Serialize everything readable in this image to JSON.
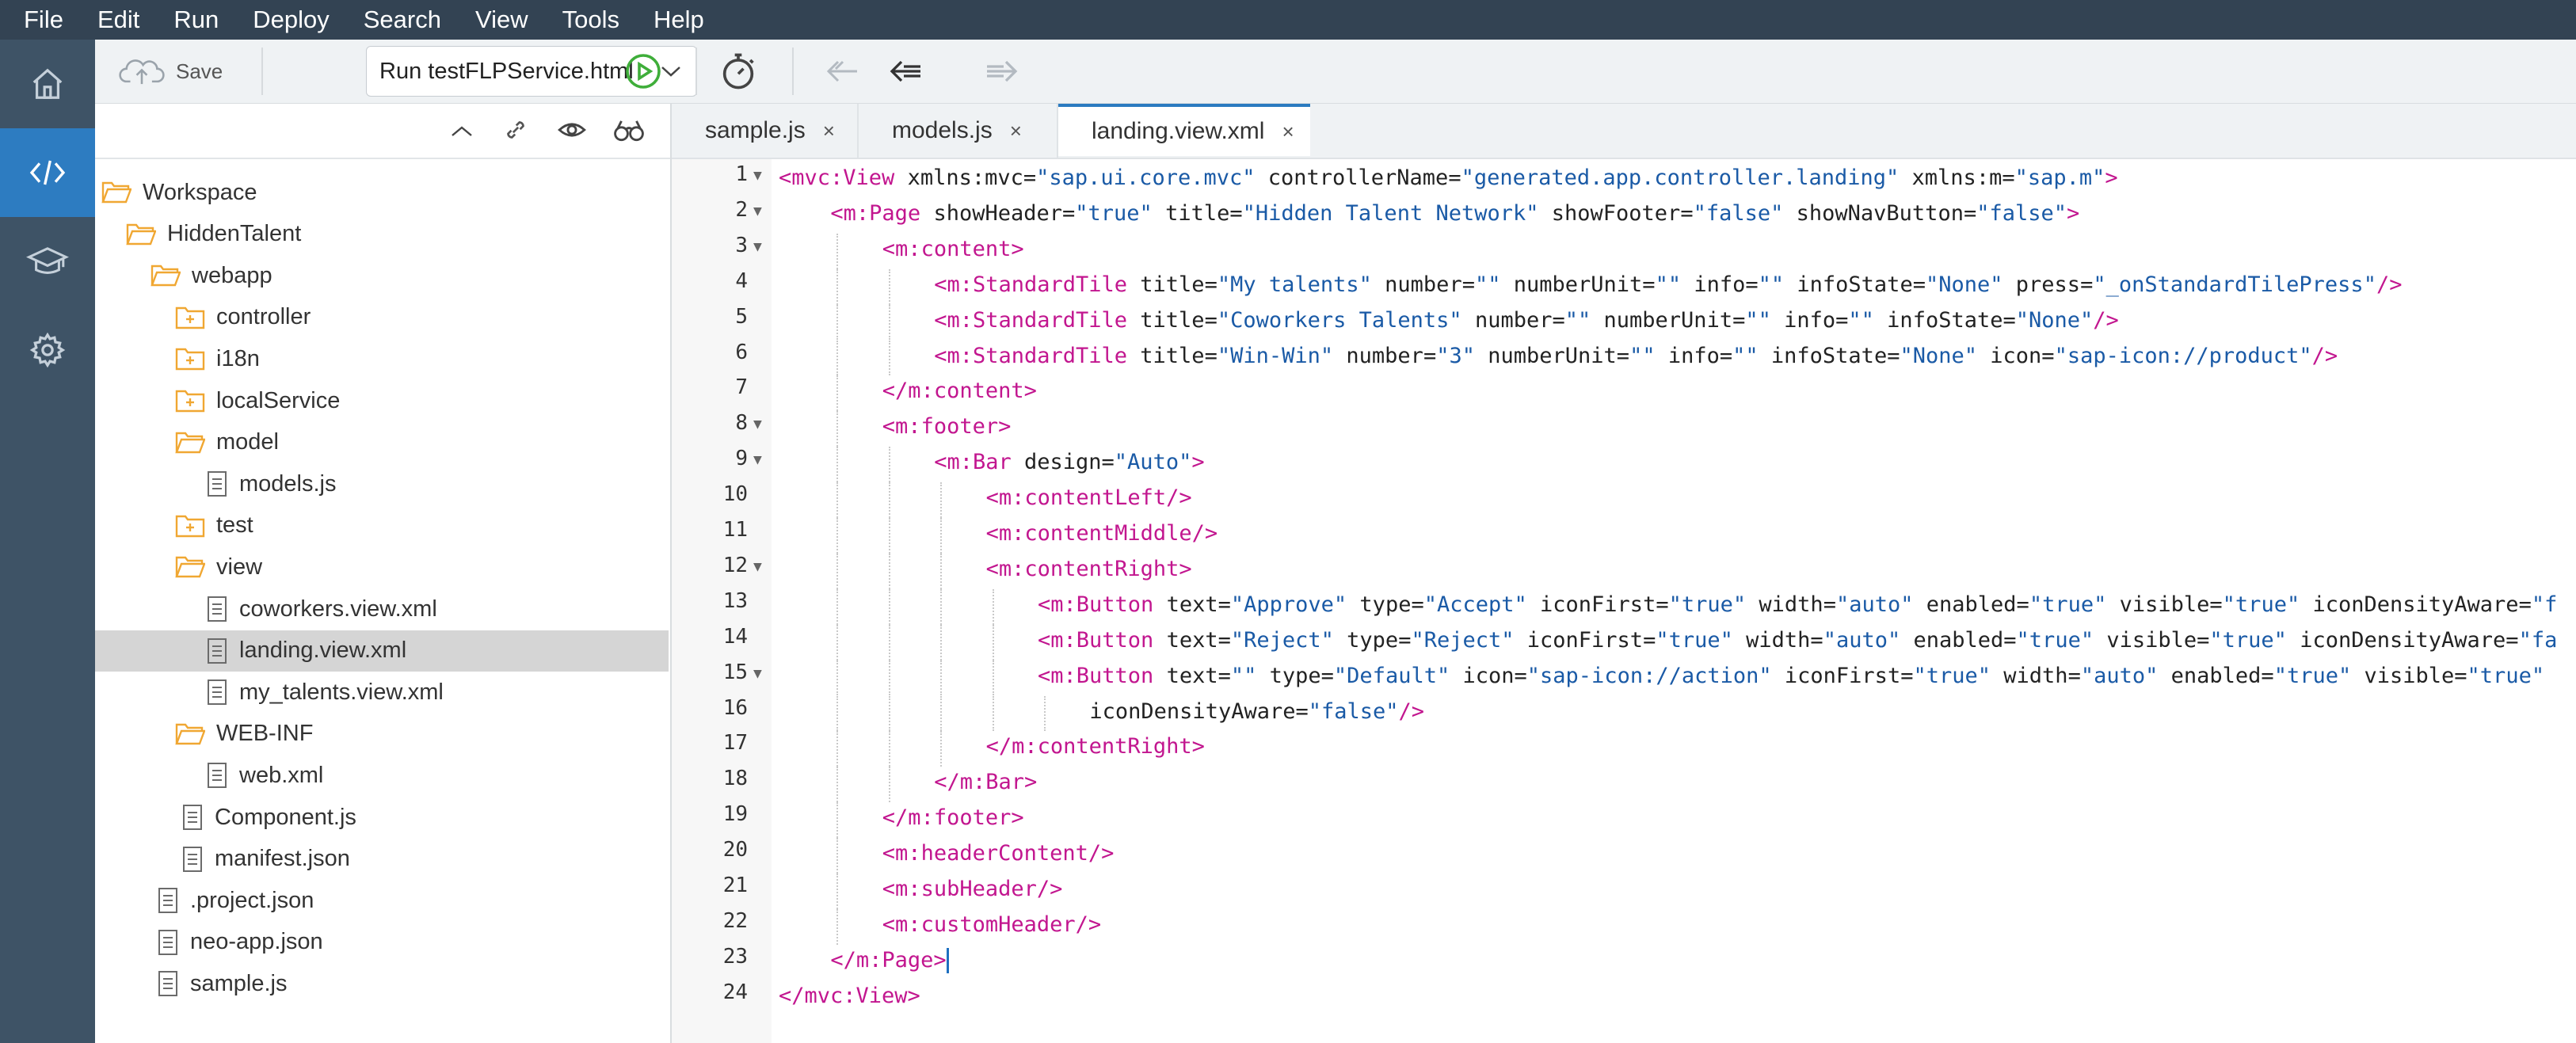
{
  "menu": [
    "File",
    "Edit",
    "Run",
    "Deploy",
    "Search",
    "View",
    "Tools",
    "Help"
  ],
  "toolbar": {
    "save_label": "Save",
    "run_config": "Run testFLPService.html"
  },
  "tree": [
    {
      "label": "Workspace",
      "type": "folder-open",
      "depth": 0
    },
    {
      "label": "HiddenTalent",
      "type": "folder-open",
      "depth": 1
    },
    {
      "label": "webapp",
      "type": "folder-open",
      "depth": 2
    },
    {
      "label": "controller",
      "type": "folder-closed",
      "depth": 3
    },
    {
      "label": "i18n",
      "type": "folder-closed",
      "depth": 3
    },
    {
      "label": "localService",
      "type": "folder-closed",
      "depth": 3
    },
    {
      "label": "model",
      "type": "folder-open",
      "depth": 3
    },
    {
      "label": "models.js",
      "type": "file",
      "depth": 4
    },
    {
      "label": "test",
      "type": "folder-closed",
      "depth": 3
    },
    {
      "label": "view",
      "type": "folder-open",
      "depth": 3
    },
    {
      "label": "coworkers.view.xml",
      "type": "file",
      "depth": 4
    },
    {
      "label": "landing.view.xml",
      "type": "file",
      "depth": 4,
      "selected": true
    },
    {
      "label": "my_talents.view.xml",
      "type": "file",
      "depth": 4
    },
    {
      "label": "WEB-INF",
      "type": "folder-open",
      "depth": 3
    },
    {
      "label": "web.xml",
      "type": "file",
      "depth": 4
    },
    {
      "label": "Component.js",
      "type": "file",
      "depth": 3
    },
    {
      "label": "manifest.json",
      "type": "file",
      "depth": 3
    },
    {
      "label": ".project.json",
      "type": "file",
      "depth": 2
    },
    {
      "label": "neo-app.json",
      "type": "file",
      "depth": 2
    },
    {
      "label": "sample.js",
      "type": "file",
      "depth": 2
    }
  ],
  "tabs": [
    {
      "label": "sample.js",
      "close": "×",
      "active": false
    },
    {
      "label": "models.js",
      "close": "×",
      "active": false
    },
    {
      "label": "landing.view.xml",
      "close": "×",
      "active": true
    }
  ],
  "code_lines": [
    {
      "n": "1",
      "fold": true,
      "indent": 0,
      "tokens": [
        [
          "tag",
          "<mvc:View "
        ],
        [
          "attr",
          "xmlns:mvc"
        ],
        [
          "eq",
          "="
        ],
        [
          "str",
          "\"sap.ui.core.mvc\""
        ],
        [
          "attr",
          " controllerName"
        ],
        [
          "eq",
          "="
        ],
        [
          "str",
          "\"generated.app.controller.landing\""
        ],
        [
          "attr",
          " xmlns:m"
        ],
        [
          "eq",
          "="
        ],
        [
          "str",
          "\"sap.m\""
        ],
        [
          "tag",
          ">"
        ]
      ]
    },
    {
      "n": "2",
      "fold": true,
      "indent": 1,
      "tokens": [
        [
          "tag",
          "<m:Page "
        ],
        [
          "attr",
          "showHeader"
        ],
        [
          "eq",
          "="
        ],
        [
          "str",
          "\"true\""
        ],
        [
          "attr",
          " title"
        ],
        [
          "eq",
          "="
        ],
        [
          "str",
          "\"Hidden Talent Network\""
        ],
        [
          "attr",
          " showFooter"
        ],
        [
          "eq",
          "="
        ],
        [
          "str",
          "\"false\""
        ],
        [
          "attr",
          " showNavButton"
        ],
        [
          "eq",
          "="
        ],
        [
          "str",
          "\"false\""
        ],
        [
          "tag",
          ">"
        ]
      ]
    },
    {
      "n": "3",
      "fold": true,
      "indent": 2,
      "tokens": [
        [
          "tag",
          "<m:content>"
        ]
      ]
    },
    {
      "n": "4",
      "fold": false,
      "indent": 3,
      "tokens": [
        [
          "tag",
          "<m:StandardTile "
        ],
        [
          "attr",
          "title"
        ],
        [
          "eq",
          "="
        ],
        [
          "str",
          "\"My talents\""
        ],
        [
          "attr",
          " number"
        ],
        [
          "eq",
          "="
        ],
        [
          "str",
          "\"\""
        ],
        [
          "attr",
          " numberUnit"
        ],
        [
          "eq",
          "="
        ],
        [
          "str",
          "\"\""
        ],
        [
          "attr",
          " info"
        ],
        [
          "eq",
          "="
        ],
        [
          "str",
          "\"\""
        ],
        [
          "attr",
          " infoState"
        ],
        [
          "eq",
          "="
        ],
        [
          "str",
          "\"None\""
        ],
        [
          "attr",
          " press"
        ],
        [
          "eq",
          "="
        ],
        [
          "str",
          "\"_onStandardTilePress\""
        ],
        [
          "tag",
          "/>"
        ]
      ]
    },
    {
      "n": "5",
      "fold": false,
      "indent": 3,
      "tokens": [
        [
          "tag",
          "<m:StandardTile "
        ],
        [
          "attr",
          "title"
        ],
        [
          "eq",
          "="
        ],
        [
          "str",
          "\"Coworkers Talents\""
        ],
        [
          "attr",
          " number"
        ],
        [
          "eq",
          "="
        ],
        [
          "str",
          "\"\""
        ],
        [
          "attr",
          " numberUnit"
        ],
        [
          "eq",
          "="
        ],
        [
          "str",
          "\"\""
        ],
        [
          "attr",
          " info"
        ],
        [
          "eq",
          "="
        ],
        [
          "str",
          "\"\""
        ],
        [
          "attr",
          " infoState"
        ],
        [
          "eq",
          "="
        ],
        [
          "str",
          "\"None\""
        ],
        [
          "tag",
          "/>"
        ]
      ]
    },
    {
      "n": "6",
      "fold": false,
      "indent": 3,
      "tokens": [
        [
          "tag",
          "<m:StandardTile "
        ],
        [
          "attr",
          "title"
        ],
        [
          "eq",
          "="
        ],
        [
          "str",
          "\"Win-Win\""
        ],
        [
          "attr",
          " number"
        ],
        [
          "eq",
          "="
        ],
        [
          "str",
          "\"3\""
        ],
        [
          "attr",
          " numberUnit"
        ],
        [
          "eq",
          "="
        ],
        [
          "str",
          "\"\""
        ],
        [
          "attr",
          " info"
        ],
        [
          "eq",
          "="
        ],
        [
          "str",
          "\"\""
        ],
        [
          "attr",
          " infoState"
        ],
        [
          "eq",
          "="
        ],
        [
          "str",
          "\"None\""
        ],
        [
          "attr",
          " icon"
        ],
        [
          "eq",
          "="
        ],
        [
          "str",
          "\"sap-icon://product\""
        ],
        [
          "tag",
          "/>"
        ]
      ]
    },
    {
      "n": "7",
      "fold": false,
      "indent": 2,
      "tokens": [
        [
          "tag",
          "</m:content>"
        ]
      ]
    },
    {
      "n": "8",
      "fold": true,
      "indent": 2,
      "tokens": [
        [
          "tag",
          "<m:footer>"
        ]
      ]
    },
    {
      "n": "9",
      "fold": true,
      "indent": 3,
      "tokens": [
        [
          "tag",
          "<m:Bar "
        ],
        [
          "attr",
          "design"
        ],
        [
          "eq",
          "="
        ],
        [
          "str",
          "\"Auto\""
        ],
        [
          "tag",
          ">"
        ]
      ]
    },
    {
      "n": "10",
      "fold": false,
      "indent": 4,
      "tokens": [
        [
          "tag",
          "<m:contentLeft/>"
        ]
      ]
    },
    {
      "n": "11",
      "fold": false,
      "indent": 4,
      "tokens": [
        [
          "tag",
          "<m:contentMiddle/>"
        ]
      ]
    },
    {
      "n": "12",
      "fold": true,
      "indent": 4,
      "tokens": [
        [
          "tag",
          "<m:contentRight>"
        ]
      ]
    },
    {
      "n": "13",
      "fold": false,
      "indent": 5,
      "tokens": [
        [
          "tag",
          "<m:Button "
        ],
        [
          "attr",
          "text"
        ],
        [
          "eq",
          "="
        ],
        [
          "str",
          "\"Approve\""
        ],
        [
          "attr",
          " type"
        ],
        [
          "eq",
          "="
        ],
        [
          "str",
          "\"Accept\""
        ],
        [
          "attr",
          " iconFirst"
        ],
        [
          "eq",
          "="
        ],
        [
          "str",
          "\"true\""
        ],
        [
          "attr",
          " width"
        ],
        [
          "eq",
          "="
        ],
        [
          "str",
          "\"auto\""
        ],
        [
          "attr",
          " enabled"
        ],
        [
          "eq",
          "="
        ],
        [
          "str",
          "\"true\""
        ],
        [
          "attr",
          " visible"
        ],
        [
          "eq",
          "="
        ],
        [
          "str",
          "\"true\""
        ],
        [
          "attr",
          " iconDensityAware"
        ],
        [
          "eq",
          "="
        ],
        [
          "str",
          "\"f"
        ]
      ]
    },
    {
      "n": "14",
      "fold": false,
      "indent": 5,
      "tokens": [
        [
          "tag",
          "<m:Button "
        ],
        [
          "attr",
          "text"
        ],
        [
          "eq",
          "="
        ],
        [
          "str",
          "\"Reject\""
        ],
        [
          "attr",
          " type"
        ],
        [
          "eq",
          "="
        ],
        [
          "str",
          "\"Reject\""
        ],
        [
          "attr",
          " iconFirst"
        ],
        [
          "eq",
          "="
        ],
        [
          "str",
          "\"true\""
        ],
        [
          "attr",
          " width"
        ],
        [
          "eq",
          "="
        ],
        [
          "str",
          "\"auto\""
        ],
        [
          "attr",
          " enabled"
        ],
        [
          "eq",
          "="
        ],
        [
          "str",
          "\"true\""
        ],
        [
          "attr",
          " visible"
        ],
        [
          "eq",
          "="
        ],
        [
          "str",
          "\"true\""
        ],
        [
          "attr",
          " iconDensityAware"
        ],
        [
          "eq",
          "="
        ],
        [
          "str",
          "\"fa"
        ]
      ]
    },
    {
      "n": "15",
      "fold": true,
      "indent": 5,
      "tokens": [
        [
          "tag",
          "<m:Button "
        ],
        [
          "attr",
          "text"
        ],
        [
          "eq",
          "="
        ],
        [
          "str",
          "\"\""
        ],
        [
          "attr",
          " type"
        ],
        [
          "eq",
          "="
        ],
        [
          "str",
          "\"Default\""
        ],
        [
          "attr",
          " icon"
        ],
        [
          "eq",
          "="
        ],
        [
          "str",
          "\"sap-icon://action\""
        ],
        [
          "attr",
          " iconFirst"
        ],
        [
          "eq",
          "="
        ],
        [
          "str",
          "\"true\""
        ],
        [
          "attr",
          " width"
        ],
        [
          "eq",
          "="
        ],
        [
          "str",
          "\"auto\""
        ],
        [
          "attr",
          " enabled"
        ],
        [
          "eq",
          "="
        ],
        [
          "str",
          "\"true\""
        ],
        [
          "attr",
          " visible"
        ],
        [
          "eq",
          "="
        ],
        [
          "str",
          "\"true\""
        ]
      ]
    },
    {
      "n": "16",
      "fold": false,
      "indent": 6,
      "tokens": [
        [
          "attr",
          "iconDensityAware"
        ],
        [
          "eq",
          "="
        ],
        [
          "str",
          "\"false\""
        ],
        [
          "tag",
          "/>"
        ]
      ]
    },
    {
      "n": "17",
      "fold": false,
      "indent": 4,
      "tokens": [
        [
          "tag",
          "</m:contentRight>"
        ]
      ]
    },
    {
      "n": "18",
      "fold": false,
      "indent": 3,
      "tokens": [
        [
          "tag",
          "</m:Bar>"
        ]
      ]
    },
    {
      "n": "19",
      "fold": false,
      "indent": 2,
      "tokens": [
        [
          "tag",
          "</m:footer>"
        ]
      ]
    },
    {
      "n": "20",
      "fold": false,
      "indent": 2,
      "tokens": [
        [
          "tag",
          "<m:headerContent/>"
        ]
      ]
    },
    {
      "n": "21",
      "fold": false,
      "indent": 2,
      "tokens": [
        [
          "tag",
          "<m:subHeader/>"
        ]
      ]
    },
    {
      "n": "22",
      "fold": false,
      "indent": 2,
      "tokens": [
        [
          "tag",
          "<m:customHeader/>"
        ]
      ]
    },
    {
      "n": "23",
      "fold": false,
      "indent": 1,
      "cursor": true,
      "tokens": [
        [
          "tag",
          "</m:Page>"
        ]
      ]
    },
    {
      "n": "24",
      "fold": false,
      "indent": 0,
      "tokens": [
        [
          "tag",
          "</mvc:View>"
        ]
      ]
    }
  ],
  "colors": {
    "menubar": "#334353",
    "sidebar": "#3e5366",
    "sidebar_active": "#2d7cc1",
    "tag": "#c2168f",
    "string": "#1a5aa6",
    "folder": "#f0a732",
    "run_green": "#3fae3a"
  }
}
